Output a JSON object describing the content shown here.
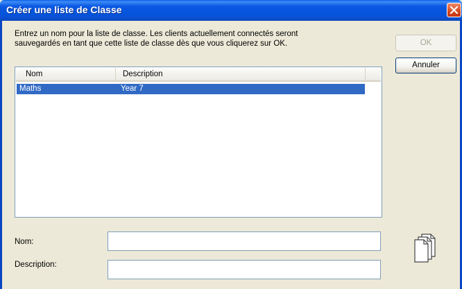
{
  "window": {
    "title": "Créer une liste de Classe"
  },
  "instructions": {
    "line1": "Entrez un nom pour la liste de classe. Les clients actuellement connectés seront",
    "line2": "sauvegardés en tant que cette liste de classe dès que vous cliquerez sur OK."
  },
  "buttons": {
    "ok": "OK",
    "cancel": "Annuler"
  },
  "list": {
    "columns": [
      "Nom",
      "Description"
    ],
    "rows": [
      {
        "nom": "Maths",
        "description": "Year 7",
        "selected": true
      }
    ]
  },
  "form": {
    "nom_label": "Nom:",
    "nom_value": "",
    "description_label": "Description:",
    "description_value": ""
  },
  "colors": {
    "titlebar": "#0654db",
    "selection": "#316ac5",
    "close": "#d8481e",
    "dialog_bg": "#ece9d8"
  },
  "icons": {
    "close": "close-icon",
    "documents": "documents-icon"
  }
}
